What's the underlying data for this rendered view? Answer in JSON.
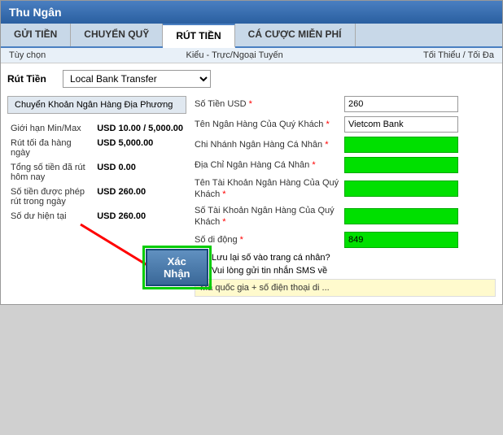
{
  "window": {
    "title": "Thu Ngân"
  },
  "tabs": [
    {
      "id": "gui-tien",
      "label": "GỬI TIỀN",
      "active": false
    },
    {
      "id": "chuyen-quy",
      "label": "CHUYỂN QUỸ",
      "active": false
    },
    {
      "id": "rut-tien",
      "label": "RÚT TIỀN",
      "active": true
    },
    {
      "id": "ca-cuoc",
      "label": "CÁ CƯỢC MIỄN PHÍ",
      "active": false
    }
  ],
  "sub_header": {
    "left": "Tùy chọn",
    "middle": "Kiểu - Trực/Ngoại Tuyến",
    "right": "Tối Thiểu / Tối Đa"
  },
  "rut_tien": {
    "label": "Rút Tiền",
    "select_value": "Local Bank Transfer",
    "select_options": [
      "Local Bank Transfer"
    ]
  },
  "left_panel": {
    "bank_btn_label": "Chuyển Khoản Ngân Hàng Địa Phương",
    "rows": [
      {
        "label": "Giới hạn Min/Max",
        "value": "USD 10.00 / 5,000.00"
      },
      {
        "label": "Rút tối đa hàng ngày",
        "value": "USD 5,000.00"
      },
      {
        "label": "Tổng số tiền đã rút hôm nay",
        "value": "USD 0.00"
      },
      {
        "label": "Số tiền được phép rút trong ngày",
        "value": "USD 260.00"
      },
      {
        "label": "Số dư hiện tại",
        "value": "USD 260.00"
      }
    ]
  },
  "right_panel": {
    "fields": [
      {
        "label": "Số Tiền USD",
        "required": true,
        "value": "260",
        "type": "normal",
        "id": "so-tien"
      },
      {
        "label": "Tên Ngân Hàng Của Quý Khách",
        "required": true,
        "value": "Vietcom Bank",
        "type": "normal",
        "id": "ten-ngan-hang"
      },
      {
        "label": "Chi Nhánh Ngân Hàng Cá Nhân",
        "required": true,
        "value": "",
        "type": "green",
        "id": "chi-nhanh"
      },
      {
        "label": "Địa Chỉ Ngân Hàng Cá Nhân",
        "required": true,
        "value": "",
        "type": "green",
        "id": "dia-chi"
      },
      {
        "label": "Tên Tài Khoản Ngân Hàng Của Quý Khách",
        "required": true,
        "value": "",
        "type": "green",
        "id": "ten-tai-khoan"
      },
      {
        "label": "Số Tài Khoản Ngân Hàng Của Quý Khách",
        "required": true,
        "value": "",
        "type": "green",
        "id": "so-tai-khoan"
      },
      {
        "label": "Số di động",
        "required": true,
        "value": "849",
        "type": "green-partial",
        "id": "so-di-dong"
      }
    ],
    "checkboxes": [
      {
        "id": "save-page",
        "checked": false,
        "label": "Lưu lại số vào trang cá nhân?"
      },
      {
        "id": "send-sms",
        "checked": true,
        "label": "Vui lòng gửi tin nhắn SMS về"
      }
    ],
    "note": "Mã quốc gia + số điện thoại di ..."
  },
  "confirm_button": {
    "label": "Xác Nhận"
  }
}
